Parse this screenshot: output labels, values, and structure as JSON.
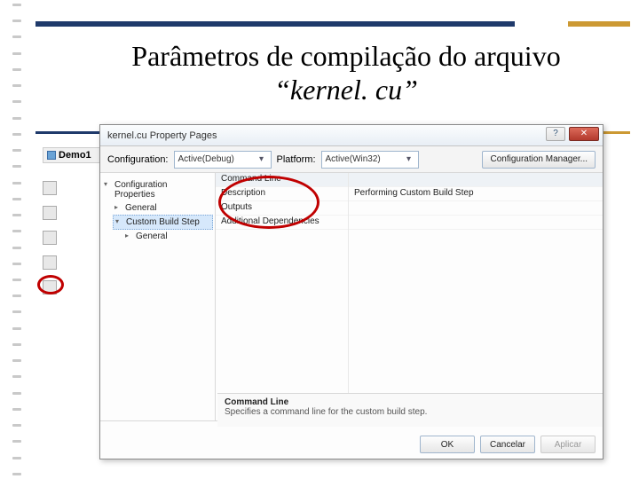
{
  "slide": {
    "title_part1": "Parâmetros de compilação do arquivo ",
    "title_italic": "“kernel. cu”"
  },
  "solution_explorer": {
    "title": "Demo1"
  },
  "dialog": {
    "title": "kernel.cu Property Pages",
    "close_glyph": "✕",
    "help_glyph": "?",
    "config_label": "Configuration:",
    "config_value": "Active(Debug)",
    "platform_label": "Platform:",
    "platform_value": "Active(Win32)",
    "config_mgr": "Configuration Manager...",
    "tree": {
      "root": "Configuration Properties",
      "general": "General",
      "custom_build": "Custom Build Step",
      "custom_general": "General"
    },
    "grid": {
      "labels": [
        "Command Line",
        "Description",
        "Outputs",
        "Additional Dependencies"
      ],
      "values": [
        "",
        "Performing Custom Build Step",
        "",
        ""
      ]
    },
    "desc": {
      "title": "Command Line",
      "text": "Specifies a command line for the custom build step."
    },
    "buttons": {
      "ok": "OK",
      "cancel": "Cancelar",
      "apply": "Aplicar"
    }
  }
}
